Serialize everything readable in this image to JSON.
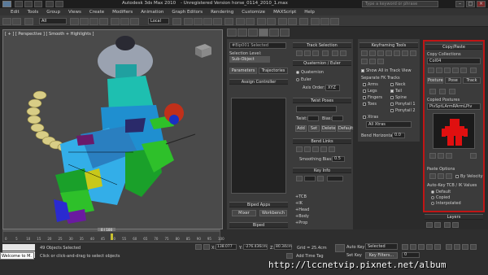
{
  "titlebar": {
    "app_title": "Autodesk 3ds Max 2010",
    "version_note": "- Unregistered Version",
    "file_name": "horse_0114_2010_1.max",
    "search_placeholder": "Type a keyword or phrase"
  },
  "menu": [
    "Edit",
    "Tools",
    "Group",
    "Views",
    "Create",
    "Modifiers",
    "Animation",
    "Graph Editors",
    "Rendering",
    "Customize",
    "MAXScript",
    "Help"
  ],
  "toolbar": {
    "selection_filter": "All",
    "ref_coord": "Local"
  },
  "viewport": {
    "label": "[ + ] [ Perspective ] [ Smooth + Highlights ]"
  },
  "panel_a": {
    "selected_object": "#Bip001 Selected",
    "selection_level_label": "Selection Level:",
    "selection_level_value": "Sub-Object",
    "tabs": [
      "Parameters",
      "Trajectories"
    ],
    "assign_controller": "Assign Controller",
    "biped_apps": "Biped Apps",
    "app_buttons": [
      "Mixer",
      "Workbench"
    ],
    "biped_section": "Biped"
  },
  "panel_b": {
    "track_selection": "Track Selection",
    "quaternion_euler": "Quaternion / Euler",
    "radio_quaternion": "Quaternion",
    "radio_euler": "Euler",
    "axis_order_label": "Axis Order:",
    "axis_order_value": "XYZ",
    "twist_poses": "Twist Poses",
    "twist_label": "Twist:",
    "bias_label": "Bias:",
    "twist_buttons": [
      "Add",
      "Set",
      "Delete",
      "Default"
    ],
    "bend_links": "Bend Links",
    "smoothing_bias_label": "Smoothing Bias:",
    "smoothing_bias_value": "0.5",
    "key_info": "Key Info",
    "key_rows": [
      "+TCB",
      "+IK",
      "+Head",
      "+Body",
      "+Prop"
    ]
  },
  "panel_c": {
    "keyframing_tools": "Keyframing Tools",
    "show_all": "Show All in Track View",
    "separate_fk": "Separate FK Tracks",
    "fk_tracks": [
      "Arms",
      "Neck",
      "Legs",
      "Tail",
      "Fingers",
      "Spine",
      "Toes",
      "Ponytail 1",
      "",
      "Ponytail 2"
    ],
    "xtras_label": "Xtras",
    "xtras_value": "All Xtras",
    "bend_horizontal_label": "Bend Horizontal:",
    "bend_horizontal_value": "0.0"
  },
  "panel_d": {
    "copy_paste": "Copy/Paste",
    "copy_collections": "Copy Collections",
    "collection_name": "Col04",
    "tabs": [
      "Posture",
      "Pose",
      "Track"
    ],
    "copied_postures": "Copied Postures",
    "posture_name": "PivSptLArmRArmLPiv",
    "paste_options": "Paste Options",
    "by_velocity": "By Velocity",
    "auto_key": "Auto-Key TCB / IK Values",
    "radio_default": "Default",
    "radio_copied": "Copied",
    "radio_interpolated": "Interpolated",
    "layers": "Layers"
  },
  "status": {
    "frame_display": "0 / 100",
    "ticks": [
      "0",
      "5",
      "10",
      "15",
      "20",
      "25",
      "30",
      "35",
      "40",
      "45",
      "50",
      "55",
      "60",
      "65",
      "70",
      "75",
      "80",
      "85",
      "90",
      "95",
      "100"
    ],
    "objects_selected": "49 Objects Selected",
    "prompt": "Click or click-and-drag to select objects",
    "x_label": "X:",
    "x_value": "138.077",
    "y_label": "Y:",
    "y_value": "-276.436cm",
    "z_label": "Z:",
    "z_value": "80.34cm",
    "grid": "Grid = 25.4cm",
    "add_time_tag": "Add Time Tag",
    "auto_key_label": "Auto Key",
    "auto_key_mode": "Selected",
    "set_key_label": "Set Key",
    "key_filters": "Key Filters...",
    "frame_number": "0"
  },
  "taskbar": {
    "welcome": "Welcome to M."
  },
  "watermark": "http://lccnetvip.pixnet.net/album"
}
